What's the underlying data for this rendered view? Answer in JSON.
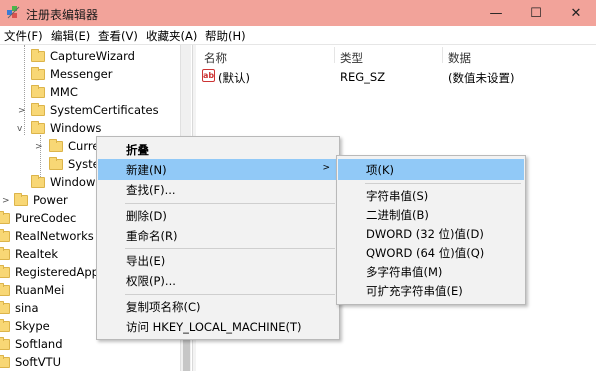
{
  "window": {
    "title": "注册表编辑器",
    "controls": {
      "minimize": "—",
      "maximize": "☐",
      "close": "✕"
    }
  },
  "menu": [
    "文件(F)",
    "编辑(E)",
    "查看(V)",
    "收藏夹(A)",
    "帮助(H)"
  ],
  "tree": {
    "items": [
      {
        "label": "CaptureWizard"
      },
      {
        "label": "Messenger"
      },
      {
        "label": "MMC"
      },
      {
        "label": "SystemCertificates"
      },
      {
        "label": "Windows"
      },
      {
        "label": "Curre"
      },
      {
        "label": "Syster"
      },
      {
        "label": "Windows"
      },
      {
        "label": "Power"
      },
      {
        "label": "PureCodec"
      },
      {
        "label": "RealNetworks"
      },
      {
        "label": "Realtek"
      },
      {
        "label": "RegisteredAppl"
      },
      {
        "label": "RuanMei"
      },
      {
        "label": "sina"
      },
      {
        "label": "Skype"
      },
      {
        "label": "Softland"
      },
      {
        "label": "SoftVTU"
      }
    ]
  },
  "list": {
    "columns": [
      "名称",
      "类型",
      "数据"
    ],
    "rows": [
      {
        "name": "(默认)",
        "type": "REG_SZ",
        "data": "(数值未设置)",
        "icon": "ab"
      }
    ]
  },
  "context_menu": {
    "items": [
      {
        "label": "折叠",
        "bold": true
      },
      {
        "label": "新建(N)",
        "submenu": true
      },
      {
        "label": "查找(F)..."
      },
      {
        "label": "删除(D)"
      },
      {
        "label": "重命名(R)"
      },
      {
        "label": "导出(E)"
      },
      {
        "label": "权限(P)..."
      },
      {
        "label": "复制项名称(C)"
      },
      {
        "label": "访问 HKEY_LOCAL_MACHINE(T)"
      }
    ]
  },
  "submenu": {
    "items": [
      {
        "label": "项(K)"
      },
      {
        "label": "字符串值(S)"
      },
      {
        "label": "二进制值(B)"
      },
      {
        "label": "DWORD (32 位)值(D)"
      },
      {
        "label": "QWORD (64 位)值(Q)"
      },
      {
        "label": "多字符串值(M)"
      },
      {
        "label": "可扩充字符串值(E)"
      }
    ]
  },
  "colors": {
    "titlebar": "#f2a39a",
    "highlight": "#91c9f7",
    "menu_bg": "#f2f2f2",
    "folder": "#f8d775"
  }
}
